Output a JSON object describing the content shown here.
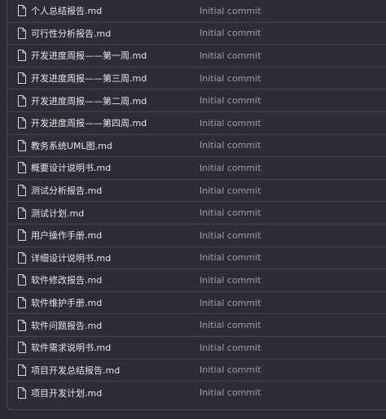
{
  "files": [
    {
      "name": "个人总结报告.md",
      "commit": "Initial commit",
      "icon": "file-icon"
    },
    {
      "name": "可行性分析报告.md",
      "commit": "Initial commit",
      "icon": "file-icon"
    },
    {
      "name": "开发进度周报——第一周.md",
      "commit": "Initial commit",
      "icon": "file-icon"
    },
    {
      "name": "开发进度周报——第三周.md",
      "commit": "Initial commit",
      "icon": "file-icon"
    },
    {
      "name": "开发进度周报——第二周.md",
      "commit": "Initial commit",
      "icon": "file-icon"
    },
    {
      "name": "开发进度周报——第四周.md",
      "commit": "Initial commit",
      "icon": "file-icon"
    },
    {
      "name": "教务系统UML图.md",
      "commit": "Initial commit",
      "icon": "file-icon"
    },
    {
      "name": "概要设计说明书.md",
      "commit": "Initial commit",
      "icon": "file-icon"
    },
    {
      "name": "测试分析报告.md",
      "commit": "Initial commit",
      "icon": "file-icon"
    },
    {
      "name": "测试计划.md",
      "commit": "Initial commit",
      "icon": "file-icon"
    },
    {
      "name": "用户操作手册.md",
      "commit": "Initial commit",
      "icon": "file-icon"
    },
    {
      "name": "详细设计说明书.md",
      "commit": "Initial commit",
      "icon": "file-icon"
    },
    {
      "name": "软件修改报告.md",
      "commit": "Initial commit",
      "icon": "file-icon"
    },
    {
      "name": "软件维护手册.md",
      "commit": "Initial commit",
      "icon": "file-icon"
    },
    {
      "name": "软件问题报告.md",
      "commit": "Initial commit",
      "icon": "file-icon"
    },
    {
      "name": "软件需求说明书.md",
      "commit": "Initial commit",
      "icon": "file-icon"
    },
    {
      "name": "项目开发总结报告.md",
      "commit": "Initial commit",
      "icon": "file-icon"
    },
    {
      "name": "项目开发计划.md",
      "commit": "Initial commit",
      "icon": "file-icon"
    }
  ],
  "colors": {
    "background": "#2b2a33",
    "text": "#e6e6ea",
    "muted": "#9d9ca6",
    "border": "#45444c"
  }
}
